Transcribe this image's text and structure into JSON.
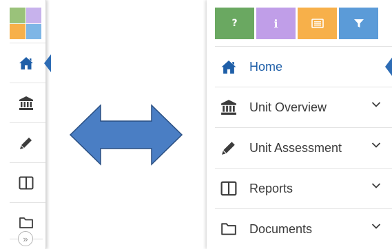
{
  "colors": {
    "accent_blue": "#1f5fa8",
    "pointer_blue": "#2d6cb5",
    "help_green": "#6aa861",
    "info_purple": "#c09ee8",
    "notes_orange": "#f7b04a",
    "filter_blue": "#5b9bd8",
    "icon_gray": "#3c3c3c",
    "arrow_fill": "#4a7ec4",
    "arrow_stroke": "#2a4f82"
  },
  "logo": {
    "tiles": [
      "#9ac27a",
      "#c7b2ec",
      "#f7b04a",
      "#7eb6e6"
    ],
    "icon": "app-logo"
  },
  "collapsed_sidebar": {
    "items": [
      {
        "icon": "home-icon",
        "active": true
      },
      {
        "icon": "bank-icon",
        "active": false
      },
      {
        "icon": "pencil-icon",
        "active": false
      },
      {
        "icon": "columns-icon",
        "active": false
      },
      {
        "icon": "folder-icon",
        "active": false
      }
    ],
    "expand_label": "»"
  },
  "toolbar": {
    "buttons": [
      {
        "icon": "question-icon",
        "glyph": "?"
      },
      {
        "icon": "info-icon",
        "glyph": "i"
      },
      {
        "icon": "notes-icon",
        "glyph": ""
      },
      {
        "icon": "filter-icon",
        "glyph": ""
      }
    ]
  },
  "expanded_sidebar": {
    "items": [
      {
        "icon": "home-icon",
        "label": "Home",
        "active": true
      },
      {
        "icon": "bank-icon",
        "label": "Unit Overview",
        "active": false
      },
      {
        "icon": "pencil-icon",
        "label": "Unit Assessment",
        "active": false
      },
      {
        "icon": "columns-icon",
        "label": "Reports",
        "active": false
      },
      {
        "icon": "folder-icon",
        "label": "Documents",
        "active": false
      }
    ]
  }
}
